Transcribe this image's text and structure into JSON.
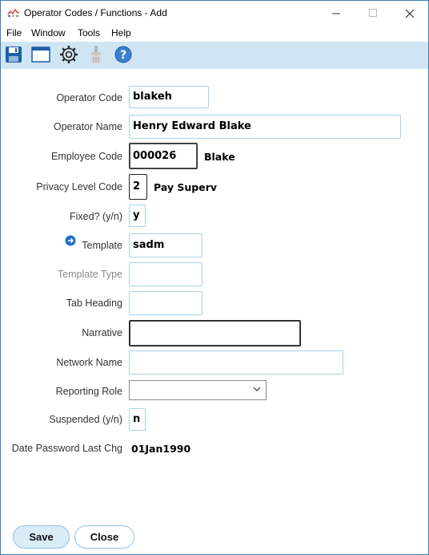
{
  "window": {
    "title": "Operator Codes / Functions - Add"
  },
  "menu": {
    "items": [
      "File",
      "Window",
      "Tools",
      "Help"
    ]
  },
  "toolbar": {
    "icons": [
      "save-icon",
      "window-icon",
      "gear-icon",
      "brush-icon",
      "help-icon"
    ]
  },
  "form": {
    "operator_code": {
      "label": "Operator Code",
      "value": "blakeh"
    },
    "operator_name": {
      "label": "Operator Name",
      "value": "Henry Edward Blake"
    },
    "employee_code": {
      "label": "Employee Code",
      "value": "000026",
      "desc": "Blake"
    },
    "privacy_level": {
      "label": "Privacy Level Code",
      "value": "2",
      "desc": "Pay Superv"
    },
    "fixed": {
      "label": "Fixed? (y/n)",
      "value": "y"
    },
    "template": {
      "label": "Template",
      "value": "sadm"
    },
    "template_type": {
      "label": "Template Type",
      "value": ""
    },
    "tab_heading": {
      "label": "Tab Heading",
      "value": ""
    },
    "narrative": {
      "label": "Narrative",
      "value": ""
    },
    "network_name": {
      "label": "Network Name",
      "value": ""
    },
    "reporting_role": {
      "label": "Reporting Role",
      "value": ""
    },
    "suspended": {
      "label": "Suspended (y/n)",
      "value": "n"
    },
    "date_password": {
      "label": "Date Password Last Chg",
      "value": "01Jan1990"
    }
  },
  "buttons": {
    "save": "Save",
    "close": "Close"
  },
  "colors": {
    "toolbar_bg": "#cfe5f3",
    "field_border": "#a9d3e8",
    "window_border": "#3c7fb1",
    "save_button_bg": "#d9ecf8"
  }
}
